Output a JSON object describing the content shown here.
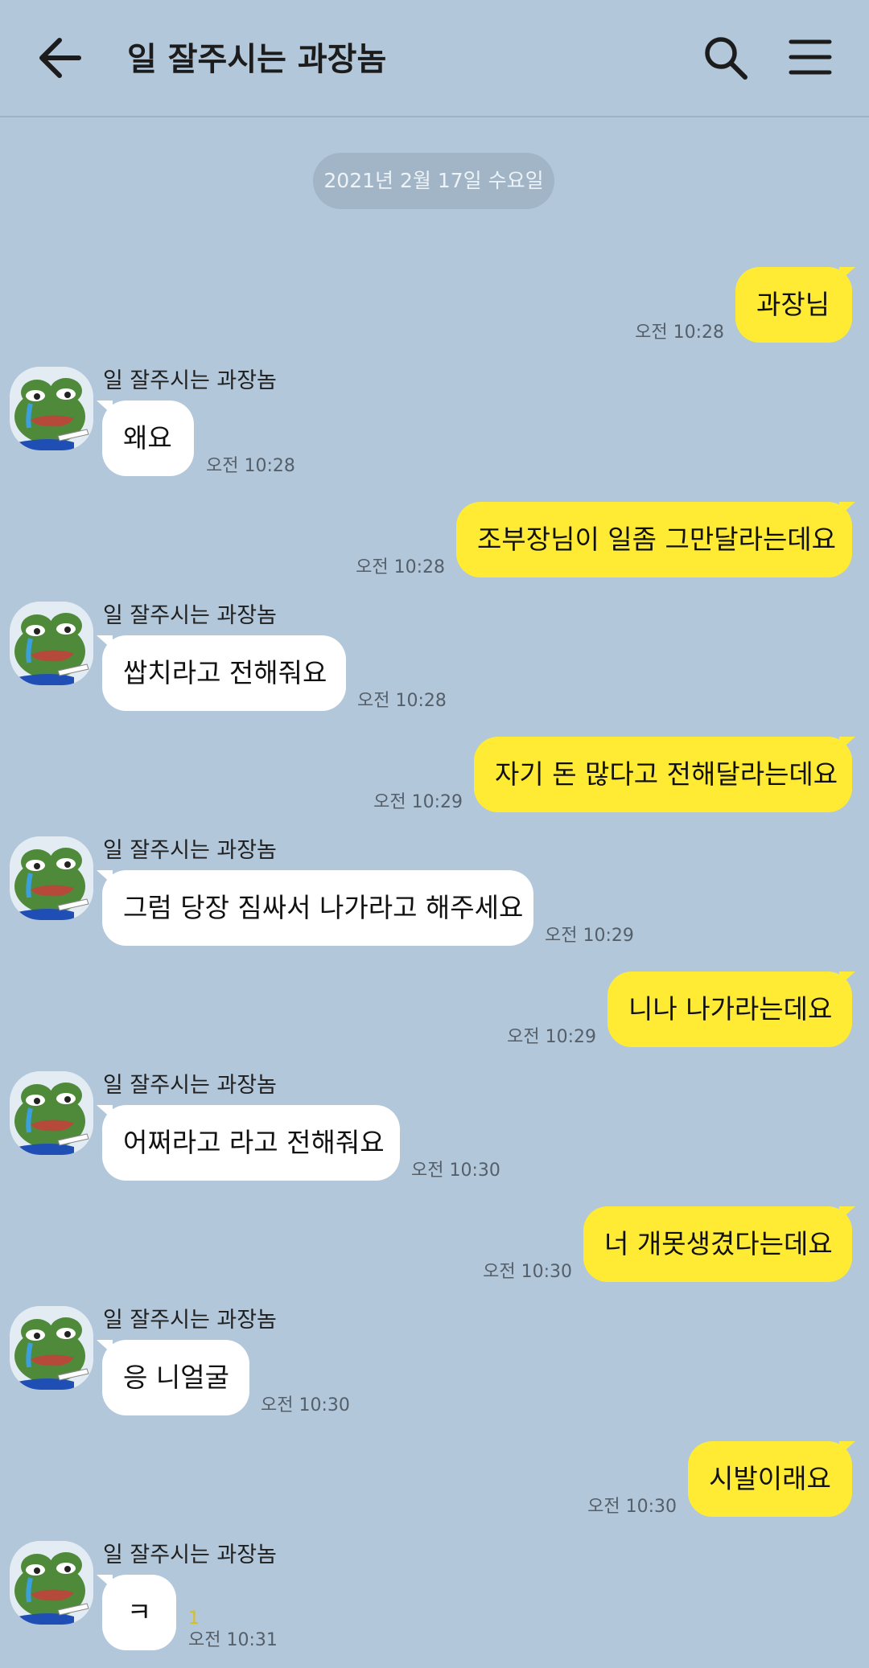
{
  "header": {
    "title": "일 잘주시는 과장놈",
    "icons": {
      "back": "back-arrow-icon",
      "search": "search-icon",
      "menu": "hamburger-menu-icon"
    }
  },
  "date_divider": "2021년 2월 17일 수요일",
  "sender_name": "일 잘주시는 과장놈",
  "colors": {
    "background": "#b2c7da",
    "my_bubble": "#ffeb33",
    "their_bubble": "#ffffff",
    "unread": "#d8bf1e"
  },
  "messages": [
    {
      "from": "me",
      "text": "과장님",
      "time": "오전 10:28"
    },
    {
      "from": "them",
      "text": "왜요",
      "time": "오전 10:28"
    },
    {
      "from": "me",
      "text": "조부장님이 일좀 그만달라는데요",
      "time": "오전 10:28"
    },
    {
      "from": "them",
      "text": "쌉치라고 전해줘요",
      "time": "오전 10:28"
    },
    {
      "from": "me",
      "text": "자기 돈 많다고 전해달라는데요",
      "time": "오전 10:29"
    },
    {
      "from": "them",
      "text": "그럼 당장 짐싸서 나가라고 해주세요",
      "time": "오전 10:29"
    },
    {
      "from": "me",
      "text": "니나 나가라는데요",
      "time": "오전 10:29"
    },
    {
      "from": "them",
      "text": "어쩌라고 라고 전해줘요",
      "time": "오전 10:30"
    },
    {
      "from": "me",
      "text": "너 개못생겼다는데요",
      "time": "오전 10:30"
    },
    {
      "from": "them",
      "text": "응 니얼굴",
      "time": "오전 10:30"
    },
    {
      "from": "me",
      "text": "시발이래요",
      "time": "오전 10:30"
    },
    {
      "from": "them",
      "text": "ㅋ",
      "time": "오전 10:31",
      "unread": "1"
    }
  ]
}
